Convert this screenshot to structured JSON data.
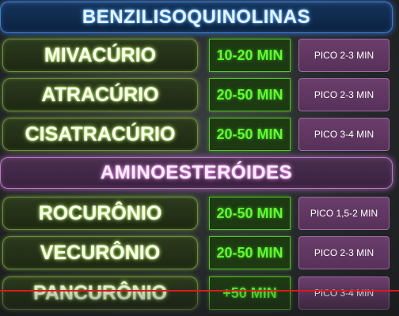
{
  "headers": {
    "benzil": "BENZILISOQUINOLINAS",
    "amino": "AMINOESTERÓIDES"
  },
  "rows": [
    {
      "drug": "MIVACÚRIO",
      "duration": "10-20 MIN",
      "peak": "PICO 2-3 MIN"
    },
    {
      "drug": "ATRACÚRIO",
      "duration": "20-50 MIN",
      "peak": "PICO 2-3 MIN"
    },
    {
      "drug": "CISATRACÚRIO",
      "duration": "20-50 MIN",
      "peak": "PICO 3-4 MIN"
    },
    {
      "drug": "ROCURÔNIO",
      "duration": "20-50 MIN",
      "peak": "PICO 1,5-2 MIN"
    },
    {
      "drug": "VECURÔNIO",
      "duration": "20-50 MIN",
      "peak": "PICO 2-3 MIN"
    },
    {
      "drug": "PANCURÔNIO",
      "duration": "+50 MIN",
      "peak": "PICO 3-4 MIN"
    }
  ],
  "colors": {
    "header_blue": "#15345a",
    "header_purple": "#4a2f4f",
    "drug_glow": "#b9ff58",
    "duration_text": "#5cff2c",
    "peak_bg": "#6a3e6b",
    "annotation_line": "#e0181a"
  }
}
